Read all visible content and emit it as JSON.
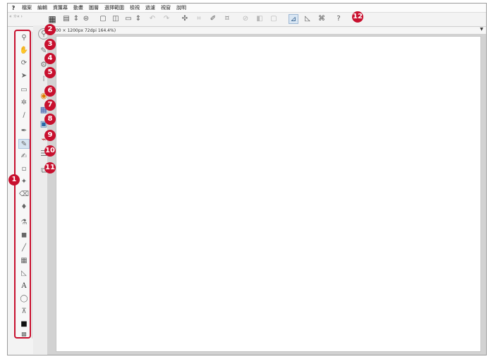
{
  "menubar": {
    "app_icon": "?",
    "items": [
      "檔案",
      "編輯",
      "資簾幕",
      "動畫",
      "圖層",
      "選擇範圍",
      "檢視",
      "過濾",
      "視窗",
      "說明"
    ]
  },
  "canvas": {
    "status_text": "(1600 × 1200px 72dpi 164.4%)"
  },
  "panel_header": {
    "left_text": "« ☼« ›",
    "close_text": "×"
  },
  "tools": {
    "icons": [
      "magnifier-icon",
      "hand-icon",
      "rotate-icon",
      "move-icon",
      "select-rect-icon",
      "auto-select-icon",
      "eyedropper-icon",
      "pen-icon",
      "pencil-icon",
      "brush-icon",
      "airbrush-icon",
      "decoration-icon",
      "eraser-icon",
      "blend-icon",
      "fill-icon",
      "gradient-icon",
      "figure-icon",
      "frame-icon",
      "ruler-icon",
      "text-icon",
      "balloon-icon",
      "correct-line-icon",
      "color-icon",
      "transparent-icon"
    ]
  },
  "badges": [
    "1",
    "2",
    "3",
    "4",
    "5",
    "6",
    "7",
    "8",
    "9",
    "10",
    "11",
    "12"
  ],
  "colors": {
    "accent": "#c8102e"
  }
}
